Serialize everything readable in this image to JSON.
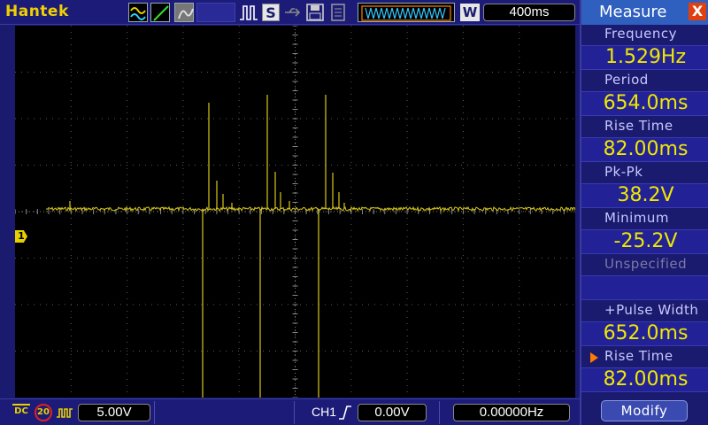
{
  "topbar": {
    "brand": "Hantek",
    "stop_label": "S",
    "window_label": "W",
    "timebase": "400ms",
    "icons": [
      "run-mode-icon",
      "edge-icon",
      "persist-icon",
      "pulse-icon",
      "usb-icon",
      "save-icon",
      "file-icon"
    ]
  },
  "screen": {
    "ch1_marker": "1",
    "trace_color": "#d8c81a"
  },
  "measure": {
    "title": "Measure",
    "close_label": "X",
    "items": [
      {
        "label": "Frequency",
        "value": "1.529Hz"
      },
      {
        "label": "Period",
        "value": "654.0ms"
      },
      {
        "label": "Rise Time",
        "value": "82.00ms"
      },
      {
        "label": "Pk-Pk",
        "value": "38.2V"
      },
      {
        "label": "Minimum",
        "value": "-25.2V"
      },
      {
        "label": "Unspecified",
        "value": ""
      },
      {
        "label": "+Pulse Width",
        "value": "652.0ms"
      },
      {
        "label": "Rise Time",
        "value": "82.00ms"
      }
    ],
    "modify_label": "Modify"
  },
  "bottombar": {
    "coupling": "DC",
    "bw_limit": "20",
    "ch1_volts": "5.00V",
    "trigger_source": "CH1",
    "trigger_level": "0.00V",
    "frequency_counter": "0.00000Hz"
  },
  "colors": {
    "background": "#1a1a6e",
    "trace": "#d8c81a",
    "brand": "#f0d000",
    "accent": "#2f5fbf",
    "value_text": "#f0e800"
  }
}
